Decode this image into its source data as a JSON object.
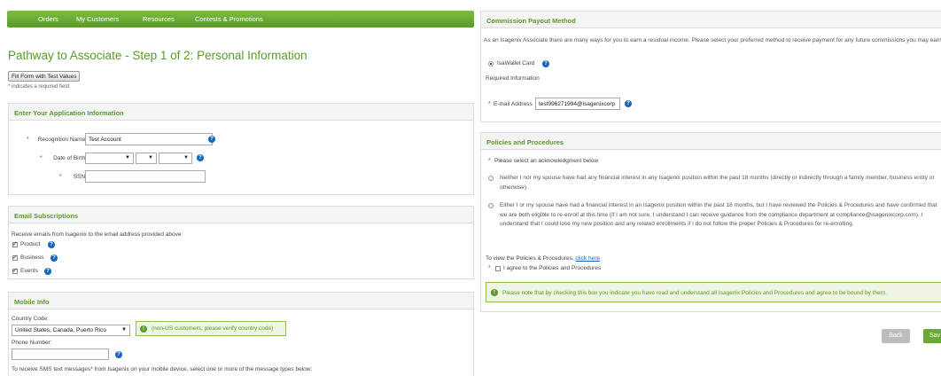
{
  "nav": {
    "items": [
      "Orders",
      "My Customers",
      "Resources",
      "Contests & Promotions"
    ]
  },
  "page": {
    "title": "Pathway to Associate - Step 1 of 2: Personal Information",
    "fill_button": "Fill Form with Test Values",
    "required_note": "indicates a required field",
    "required_marker": "*"
  },
  "application": {
    "heading": "Enter Your Application Information",
    "recognition_label": "Recognition Name:",
    "recognition_value": "Test Account",
    "dob_label": "Date of Birth:",
    "ssn_label": "SSN:",
    "ssn_value": ""
  },
  "email": {
    "heading": "Email Subscriptions",
    "intro": "Receive emails from Isagenix to the email address provided above",
    "options": [
      "Product",
      "Business",
      "Events"
    ]
  },
  "mobile": {
    "heading": "Mobile Info",
    "country_label": "Country Code:",
    "country_value": "United States, Canada, Puerto Rico",
    "country_note": "(non-US customers, please verify country code)",
    "phone_label": "Phone Number:",
    "phone_value": "",
    "sms_text": "To receive SMS text messages* from Isagenix on your mobile device, select one or more of the message types below:"
  },
  "commission": {
    "heading": "Commission Payout Method",
    "intro": "As an Isagenix Associate there are many ways for you to earn a residual income. Please select your preferred method to receive payment for any future commissions you may earn.",
    "option": "IsaWallet Card",
    "required_info": "Required Information",
    "email_label": "E-mail Address",
    "email_value": "test996271994@isagenixcorp"
  },
  "policies": {
    "heading": "Policies and Procedures",
    "prompt": "Please select an acknowledgment below",
    "option1": "Neither I nor my spouse have had any financial interest in any Isagenix position within the past 18 months (directly or indirectly through a family member, business entity or otherwise).",
    "option2": "Either I or my spouse have had a financial interest in an Isagenix position within the past 18 months, but I have reviewed the Policies & Procedures and have confirmed that we are both eligible to re-enroll at this time (if I am not sure, I understand I can receive guidance from the compliance department at compliance@isagenixcorp.com). I understand that I could lose my new position and any related enrollments if I do not follow the proper Policies & Procedures for re-enrolling.",
    "view_text": "To view the Policies & Procedures,",
    "view_link": "click here",
    "agree_label": "I agree to the Policies and Procedures",
    "notice": "Please note that by checking this box you indicate you have read and understand all Isagenix Policies and Procedures and agree to be bound by them."
  },
  "actions": {
    "back": "Back",
    "save": "Sav"
  },
  "colors": {
    "brand_green": "#5a9a2a",
    "link_blue": "#1565c0",
    "required_red": "#d33333"
  }
}
